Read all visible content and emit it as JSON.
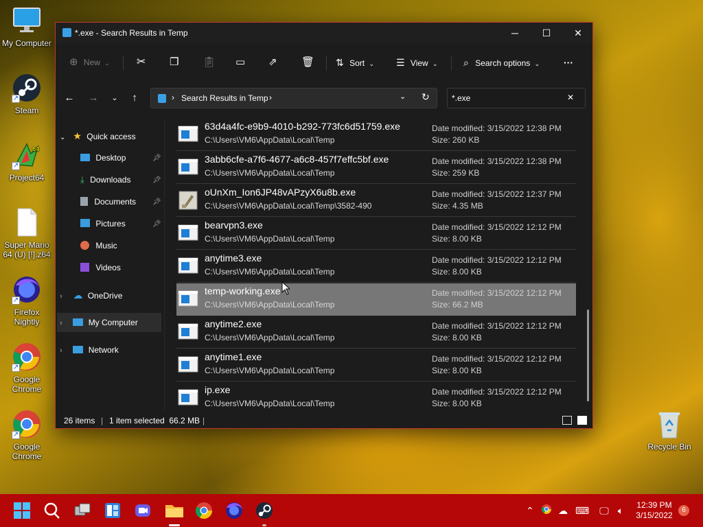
{
  "desktop": {
    "icons": [
      {
        "label": "My Computer"
      },
      {
        "label": "Steam"
      },
      {
        "label": "Project64"
      },
      {
        "label": "Super Mario 64 (U) [!].z64"
      },
      {
        "label": "Firefox Nightly"
      },
      {
        "label": "Google Chrome"
      },
      {
        "label": "Google Chrome"
      },
      {
        "label": "Recycle Bin"
      }
    ]
  },
  "window": {
    "title": "*.exe - Search Results in Temp",
    "toolbar": {
      "new_label": "New",
      "sort_label": "Sort",
      "view_label": "View",
      "search_options_label": "Search options",
      "more_label": "···"
    },
    "address": {
      "breadcrumb": "Search Results in Temp"
    },
    "search": {
      "value": "*.exe"
    },
    "nav": {
      "quick_access": "Quick access",
      "items": [
        {
          "label": "Desktop"
        },
        {
          "label": "Downloads"
        },
        {
          "label": "Documents"
        },
        {
          "label": "Pictures"
        },
        {
          "label": "Music"
        },
        {
          "label": "Videos"
        }
      ],
      "onedrive": "OneDrive",
      "my_computer": "My Computer",
      "network": "Network"
    },
    "files": [
      {
        "name": "63d4a4fc-e9b9-4010-b292-773fc6d51759.exe",
        "path": "C:\\Users\\VM6\\AppData\\Local\\Temp",
        "date": "Date modified: 3/15/2022 12:38 PM",
        "size": "Size: 260 KB",
        "icon": "exe-window-icon"
      },
      {
        "name": "3abb6cfe-a7f6-4677-a6c8-457f7effc5bf.exe",
        "path": "C:\\Users\\VM6\\AppData\\Local\\Temp",
        "date": "Date modified: 3/15/2022 12:38 PM",
        "size": "Size: 259 KB",
        "icon": "exe-window-icon"
      },
      {
        "name": "oUnXm_Ion6JP48vAPzyX6u8b.exe",
        "path": "C:\\Users\\VM6\\AppData\\Local\\Temp\\3582-490",
        "date": "Date modified: 3/15/2022 12:37 PM",
        "size": "Size: 4.35 MB",
        "icon": "installer-icon"
      },
      {
        "name": "bearvpn3.exe",
        "path": "C:\\Users\\VM6\\AppData\\Local\\Temp",
        "date": "Date modified: 3/15/2022 12:12 PM",
        "size": "Size: 8.00 KB",
        "icon": "exe-window-icon"
      },
      {
        "name": "anytime3.exe",
        "path": "C:\\Users\\VM6\\AppData\\Local\\Temp",
        "date": "Date modified: 3/15/2022 12:12 PM",
        "size": "Size: 8.00 KB",
        "icon": "exe-window-icon"
      },
      {
        "name": "temp-working.exe",
        "path": "C:\\Users\\VM6\\AppData\\Local\\Temp",
        "date": "Date modified: 3/15/2022 12:12 PM",
        "size": "Size: 66.2 MB",
        "icon": "exe-window-icon",
        "selected": true
      },
      {
        "name": "anytime2.exe",
        "path": "C:\\Users\\VM6\\AppData\\Local\\Temp",
        "date": "Date modified: 3/15/2022 12:12 PM",
        "size": "Size: 8.00 KB",
        "icon": "exe-window-icon"
      },
      {
        "name": "anytime1.exe",
        "path": "C:\\Users\\VM6\\AppData\\Local\\Temp",
        "date": "Date modified: 3/15/2022 12:12 PM",
        "size": "Size: 8.00 KB",
        "icon": "exe-window-icon"
      },
      {
        "name": "ip.exe",
        "path": "C:\\Users\\VM6\\AppData\\Local\\Temp",
        "date": "Date modified: 3/15/2022 12:12 PM",
        "size": "Size: 8.00 KB",
        "icon": "exe-window-icon"
      }
    ],
    "status": {
      "items_count": "26 items",
      "selection": "1 item selected  66.2 MB"
    }
  },
  "taskbar": {
    "clock_time": "12:39 PM",
    "clock_date": "3/15/2022",
    "notification_count": "6",
    "accent": "#b50707"
  }
}
